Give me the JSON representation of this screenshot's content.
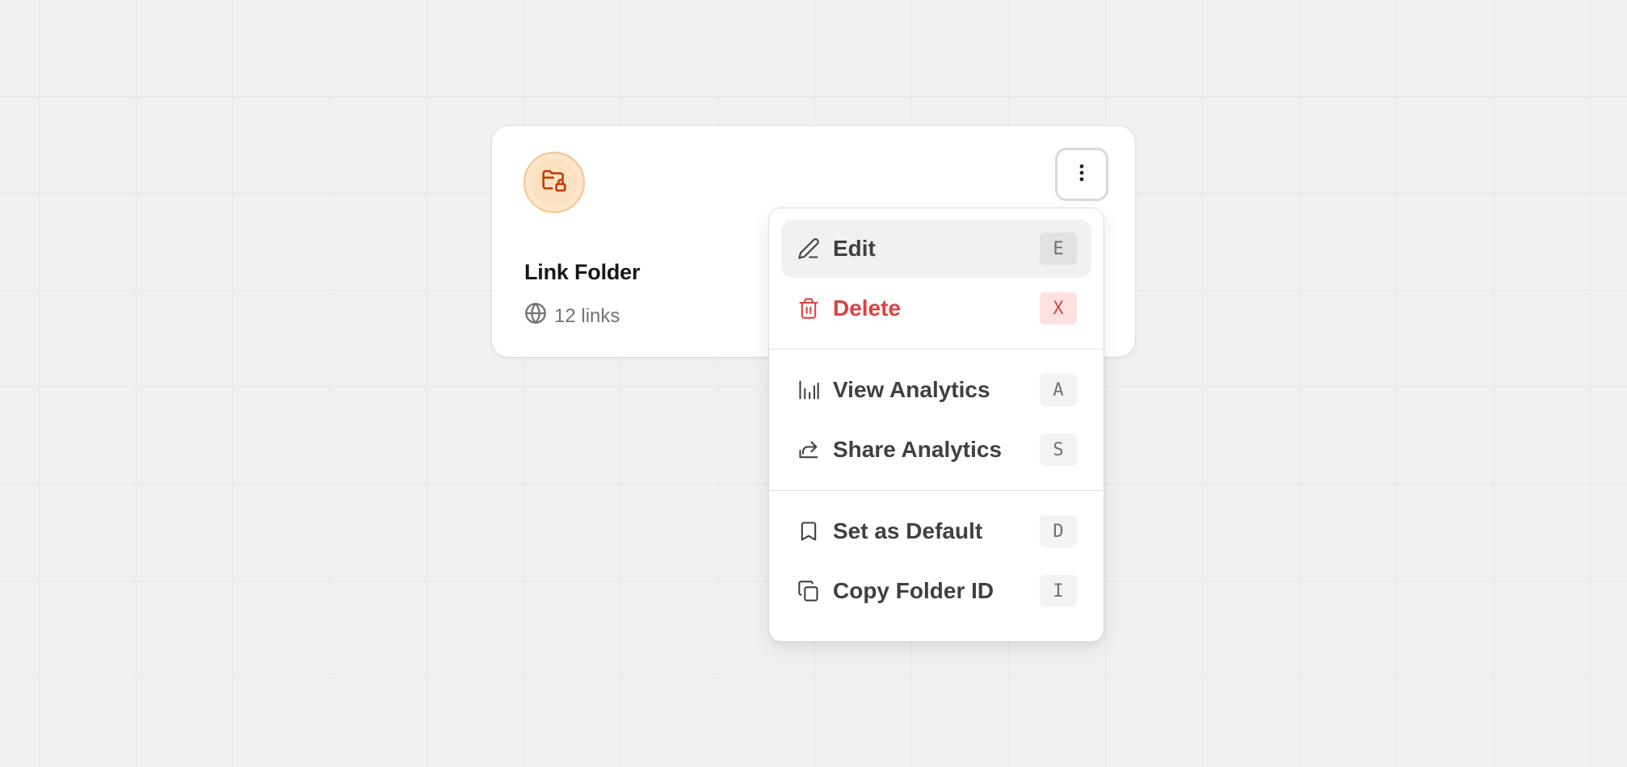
{
  "card": {
    "title": "Link Folder",
    "link_count": "12 links",
    "folder_icon": "folder-lock-icon",
    "meta_icon": "globe-icon",
    "more_icon": "kebab-vertical-icon",
    "accent_color": "#c2410c"
  },
  "menu": {
    "groups": [
      {
        "items": [
          {
            "label": "Edit",
            "icon": "pencil-icon",
            "shortcut": "E",
            "highlighted": true
          },
          {
            "label": "Delete",
            "icon": "trash-icon",
            "shortcut": "X",
            "danger": true,
            "color": "#e0403e"
          }
        ]
      },
      {
        "items": [
          {
            "label": "View Analytics",
            "icon": "bar-chart-icon",
            "shortcut": "A"
          },
          {
            "label": "Share Analytics",
            "icon": "share-icon",
            "shortcut": "S"
          }
        ]
      },
      {
        "items": [
          {
            "label": "Set as Default",
            "icon": "bookmark-icon",
            "shortcut": "D"
          },
          {
            "label": "Copy Folder ID",
            "icon": "copy-icon",
            "shortcut": "I"
          }
        ]
      }
    ]
  }
}
